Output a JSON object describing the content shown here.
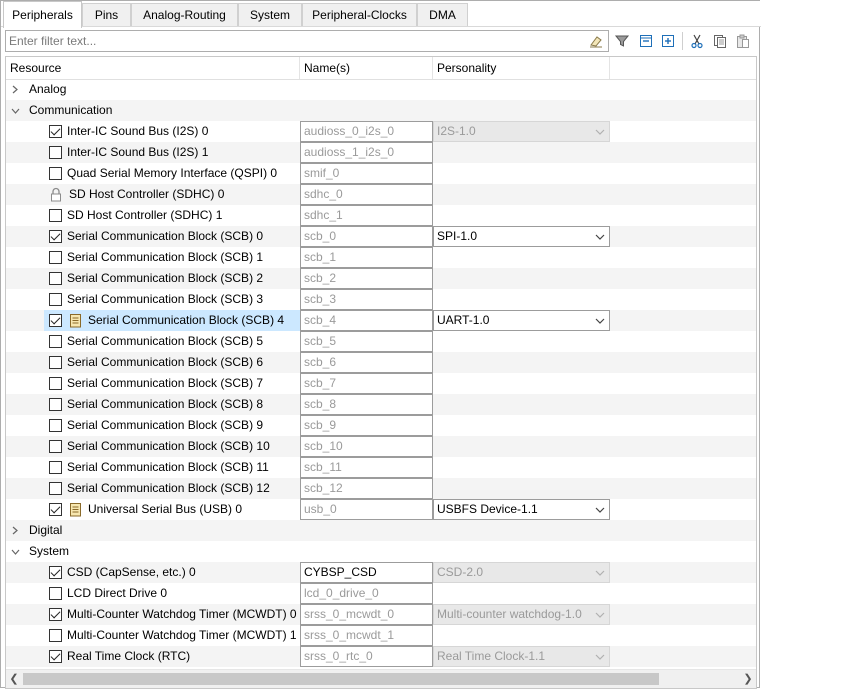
{
  "tabs": [
    "Peripherals",
    "Pins",
    "Analog-Routing",
    "System",
    "Peripheral-Clocks",
    "DMA"
  ],
  "active_tab": "Peripherals",
  "filter": {
    "placeholder": "Enter filter text..."
  },
  "toolbar_icons": [
    "clear-filter-icon",
    "filter-icon",
    "collapse-all-icon",
    "expand-all-icon",
    "cut-icon",
    "copy-icon",
    "paste-icon"
  ],
  "columns": {
    "resource": "Resource",
    "names": "Name(s)",
    "personality": "Personality"
  },
  "categories": {
    "analog": "Analog",
    "communication": "Communication",
    "digital": "Digital",
    "system": "System"
  },
  "rows": [
    {
      "label": "Inter-IC Sound Bus (I2S) 0",
      "checked": true,
      "name": "audioss_0_i2s_0",
      "personality": "I2S-1.0",
      "pers_state": "disabled"
    },
    {
      "label": "Inter-IC Sound Bus (I2S) 1",
      "checked": false,
      "name": "audioss_1_i2s_0"
    },
    {
      "label": "Quad Serial Memory Interface (QSPI) 0",
      "checked": false,
      "name": "smif_0"
    },
    {
      "label": "SD Host Controller (SDHC) 0",
      "locked": true,
      "name": "sdhc_0"
    },
    {
      "label": "SD Host Controller (SDHC) 1",
      "checked": false,
      "name": "sdhc_1"
    },
    {
      "label": "Serial Communication Block (SCB) 0",
      "checked": true,
      "name": "scb_0",
      "personality": "SPI-1.0",
      "pers_state": "enabled"
    },
    {
      "label": "Serial Communication Block (SCB) 1",
      "checked": false,
      "name": "scb_1"
    },
    {
      "label": "Serial Communication Block (SCB) 2",
      "checked": false,
      "name": "scb_2"
    },
    {
      "label": "Serial Communication Block (SCB) 3",
      "checked": false,
      "name": "scb_3"
    },
    {
      "label": "Serial Communication Block (SCB) 4",
      "checked": true,
      "doc": true,
      "selected": true,
      "name": "scb_4",
      "personality": "UART-1.0",
      "pers_state": "enabled"
    },
    {
      "label": "Serial Communication Block (SCB) 5",
      "checked": false,
      "name": "scb_5"
    },
    {
      "label": "Serial Communication Block (SCB) 6",
      "checked": false,
      "name": "scb_6"
    },
    {
      "label": "Serial Communication Block (SCB) 7",
      "checked": false,
      "name": "scb_7"
    },
    {
      "label": "Serial Communication Block (SCB) 8",
      "checked": false,
      "name": "scb_8"
    },
    {
      "label": "Serial Communication Block (SCB) 9",
      "checked": false,
      "name": "scb_9"
    },
    {
      "label": "Serial Communication Block (SCB) 10",
      "checked": false,
      "name": "scb_10"
    },
    {
      "label": "Serial Communication Block (SCB) 11",
      "checked": false,
      "name": "scb_11"
    },
    {
      "label": "Serial Communication Block (SCB) 12",
      "checked": false,
      "name": "scb_12"
    },
    {
      "label": "Universal Serial Bus (USB) 0",
      "checked": true,
      "doc": true,
      "name": "usb_0",
      "personality": "USBFS Device-1.1",
      "pers_state": "enabled"
    }
  ],
  "system_rows": [
    {
      "label": "CSD (CapSense, etc.) 0",
      "checked": true,
      "name": "CYBSP_CSD",
      "name_editable": true,
      "personality": "CSD-2.0",
      "pers_state": "disabled"
    },
    {
      "label": "LCD Direct Drive 0",
      "checked": false,
      "name": "lcd_0_drive_0"
    },
    {
      "label": "Multi-Counter Watchdog Timer (MCWDT) 0",
      "checked": true,
      "name": "srss_0_mcwdt_0",
      "personality": "Multi-counter watchdog-1.0",
      "pers_state": "disabled"
    },
    {
      "label": "Multi-Counter Watchdog Timer (MCWDT) 1",
      "checked": false,
      "name": "srss_0_mcwdt_1"
    },
    {
      "label": "Real Time Clock (RTC)",
      "checked": true,
      "name": "srss_0_rtc_0",
      "personality": "Real Time Clock-1.1",
      "pers_state": "disabled"
    }
  ],
  "colors": {
    "selection": "#cce8ff",
    "toolbar_blue": "#1e6fb8"
  }
}
